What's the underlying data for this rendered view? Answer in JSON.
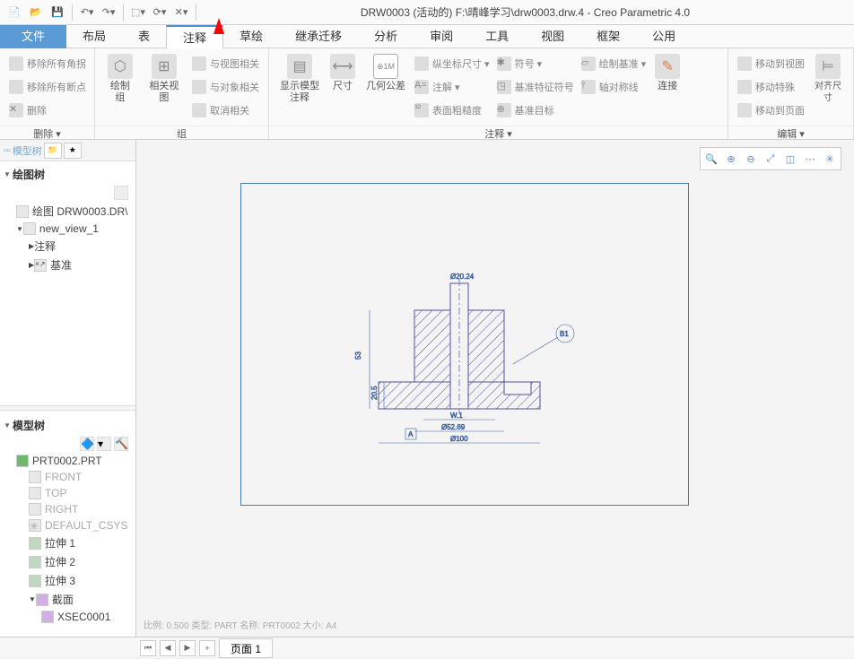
{
  "title": "DRW0003 (活动的) F:\\晴峰学习\\drw0003.drw.4 - Creo Parametric 4.0",
  "tabs": {
    "file": "文件",
    "layout": "布局",
    "table": "表",
    "annotate": "注释",
    "sketch": "草绘",
    "inherit": "继承迁移",
    "analysis": "分析",
    "review": "审阅",
    "tools": "工具",
    "view": "视图",
    "frame": "框架",
    "shared": "公用"
  },
  "ribbon": {
    "delete": {
      "label": "删除 ▾",
      "items": [
        "移除所有角拐",
        "移除所有断点",
        "删除"
      ]
    },
    "group": {
      "label": "组",
      "draw_group": "绘制组",
      "related_view": "相关视图",
      "view_related": "与视图相关",
      "object_related": "与对象相关",
      "cancel_related": "取消相关"
    },
    "annotate": {
      "label": "注释 ▾",
      "show_model": "显示模型\n注释",
      "dim": "尺寸",
      "geom_tol": "几何公差",
      "ord_dim": "纵坐标尺寸 ▾",
      "note": "注解 ▾",
      "surf_finish": "表面粗糙度",
      "symbol": "符号 ▾",
      "datum_feat": "基准特征符号",
      "datum_target": "基准目标",
      "draw_datum": "绘制基准 ▾",
      "axis_sym": "轴对称线",
      "connect": "连接"
    },
    "edit": {
      "label": "编辑 ▾",
      "move_view": "移动到视图",
      "move_special": "移动特殊",
      "move_page": "移动到页面",
      "align_dim": "对齐尺寸"
    }
  },
  "sidebar": {
    "model_tree_tab": "模型树",
    "draw_tree": "绘图树",
    "drawing": "绘图 DRW0003.DR\\",
    "new_view": "new_view_1",
    "annotate_node": "注释",
    "datum_node": "基准",
    "model_tree2": "模型树",
    "part": "PRT0002.PRT",
    "front": "FRONT",
    "top": "TOP",
    "right": "RIGHT",
    "csys": "DEFAULT_CSYS",
    "extrude1": "拉伸 1",
    "extrude2": "拉伸 2",
    "extrude3": "拉伸 3",
    "section": "截面",
    "xsec": "XSEC0001"
  },
  "drawing": {
    "dim_top": "Ø20.24",
    "dim_h1": "53",
    "dim_h2": "20.5",
    "dim_b1": "W.1",
    "dim_b2": "Ø52.69",
    "dim_b3": "Ø100",
    "datum_A": "A",
    "balloon": "B1"
  },
  "status": "比例: 0.500  类型: PART  名称: PRT0002  大小: A4",
  "bottom": {
    "page": "页面 1"
  }
}
